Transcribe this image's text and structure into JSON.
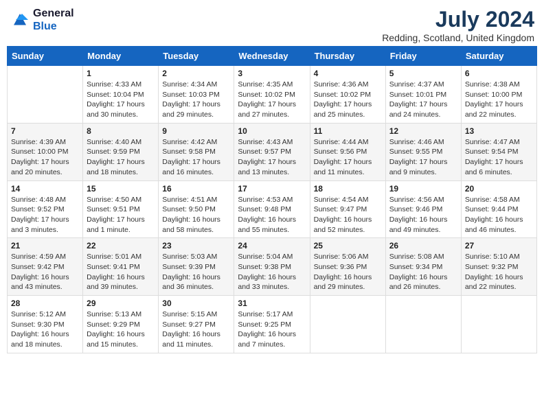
{
  "header": {
    "logo_general": "General",
    "logo_blue": "Blue",
    "month_title": "July 2024",
    "location": "Redding, Scotland, United Kingdom"
  },
  "weekdays": [
    "Sunday",
    "Monday",
    "Tuesday",
    "Wednesday",
    "Thursday",
    "Friday",
    "Saturday"
  ],
  "weeks": [
    [
      {
        "day": "",
        "sunrise": "",
        "sunset": "",
        "daylight": ""
      },
      {
        "day": "1",
        "sunrise": "Sunrise: 4:33 AM",
        "sunset": "Sunset: 10:04 PM",
        "daylight": "Daylight: 17 hours and 30 minutes."
      },
      {
        "day": "2",
        "sunrise": "Sunrise: 4:34 AM",
        "sunset": "Sunset: 10:03 PM",
        "daylight": "Daylight: 17 hours and 29 minutes."
      },
      {
        "day": "3",
        "sunrise": "Sunrise: 4:35 AM",
        "sunset": "Sunset: 10:02 PM",
        "daylight": "Daylight: 17 hours and 27 minutes."
      },
      {
        "day": "4",
        "sunrise": "Sunrise: 4:36 AM",
        "sunset": "Sunset: 10:02 PM",
        "daylight": "Daylight: 17 hours and 25 minutes."
      },
      {
        "day": "5",
        "sunrise": "Sunrise: 4:37 AM",
        "sunset": "Sunset: 10:01 PM",
        "daylight": "Daylight: 17 hours and 24 minutes."
      },
      {
        "day": "6",
        "sunrise": "Sunrise: 4:38 AM",
        "sunset": "Sunset: 10:00 PM",
        "daylight": "Daylight: 17 hours and 22 minutes."
      }
    ],
    [
      {
        "day": "7",
        "sunrise": "Sunrise: 4:39 AM",
        "sunset": "Sunset: 10:00 PM",
        "daylight": "Daylight: 17 hours and 20 minutes."
      },
      {
        "day": "8",
        "sunrise": "Sunrise: 4:40 AM",
        "sunset": "Sunset: 9:59 PM",
        "daylight": "Daylight: 17 hours and 18 minutes."
      },
      {
        "day": "9",
        "sunrise": "Sunrise: 4:42 AM",
        "sunset": "Sunset: 9:58 PM",
        "daylight": "Daylight: 17 hours and 16 minutes."
      },
      {
        "day": "10",
        "sunrise": "Sunrise: 4:43 AM",
        "sunset": "Sunset: 9:57 PM",
        "daylight": "Daylight: 17 hours and 13 minutes."
      },
      {
        "day": "11",
        "sunrise": "Sunrise: 4:44 AM",
        "sunset": "Sunset: 9:56 PM",
        "daylight": "Daylight: 17 hours and 11 minutes."
      },
      {
        "day": "12",
        "sunrise": "Sunrise: 4:46 AM",
        "sunset": "Sunset: 9:55 PM",
        "daylight": "Daylight: 17 hours and 9 minutes."
      },
      {
        "day": "13",
        "sunrise": "Sunrise: 4:47 AM",
        "sunset": "Sunset: 9:54 PM",
        "daylight": "Daylight: 17 hours and 6 minutes."
      }
    ],
    [
      {
        "day": "14",
        "sunrise": "Sunrise: 4:48 AM",
        "sunset": "Sunset: 9:52 PM",
        "daylight": "Daylight: 17 hours and 3 minutes."
      },
      {
        "day": "15",
        "sunrise": "Sunrise: 4:50 AM",
        "sunset": "Sunset: 9:51 PM",
        "daylight": "Daylight: 17 hours and 1 minute."
      },
      {
        "day": "16",
        "sunrise": "Sunrise: 4:51 AM",
        "sunset": "Sunset: 9:50 PM",
        "daylight": "Daylight: 16 hours and 58 minutes."
      },
      {
        "day": "17",
        "sunrise": "Sunrise: 4:53 AM",
        "sunset": "Sunset: 9:48 PM",
        "daylight": "Daylight: 16 hours and 55 minutes."
      },
      {
        "day": "18",
        "sunrise": "Sunrise: 4:54 AM",
        "sunset": "Sunset: 9:47 PM",
        "daylight": "Daylight: 16 hours and 52 minutes."
      },
      {
        "day": "19",
        "sunrise": "Sunrise: 4:56 AM",
        "sunset": "Sunset: 9:46 PM",
        "daylight": "Daylight: 16 hours and 49 minutes."
      },
      {
        "day": "20",
        "sunrise": "Sunrise: 4:58 AM",
        "sunset": "Sunset: 9:44 PM",
        "daylight": "Daylight: 16 hours and 46 minutes."
      }
    ],
    [
      {
        "day": "21",
        "sunrise": "Sunrise: 4:59 AM",
        "sunset": "Sunset: 9:42 PM",
        "daylight": "Daylight: 16 hours and 43 minutes."
      },
      {
        "day": "22",
        "sunrise": "Sunrise: 5:01 AM",
        "sunset": "Sunset: 9:41 PM",
        "daylight": "Daylight: 16 hours and 39 minutes."
      },
      {
        "day": "23",
        "sunrise": "Sunrise: 5:03 AM",
        "sunset": "Sunset: 9:39 PM",
        "daylight": "Daylight: 16 hours and 36 minutes."
      },
      {
        "day": "24",
        "sunrise": "Sunrise: 5:04 AM",
        "sunset": "Sunset: 9:38 PM",
        "daylight": "Daylight: 16 hours and 33 minutes."
      },
      {
        "day": "25",
        "sunrise": "Sunrise: 5:06 AM",
        "sunset": "Sunset: 9:36 PM",
        "daylight": "Daylight: 16 hours and 29 minutes."
      },
      {
        "day": "26",
        "sunrise": "Sunrise: 5:08 AM",
        "sunset": "Sunset: 9:34 PM",
        "daylight": "Daylight: 16 hours and 26 minutes."
      },
      {
        "day": "27",
        "sunrise": "Sunrise: 5:10 AM",
        "sunset": "Sunset: 9:32 PM",
        "daylight": "Daylight: 16 hours and 22 minutes."
      }
    ],
    [
      {
        "day": "28",
        "sunrise": "Sunrise: 5:12 AM",
        "sunset": "Sunset: 9:30 PM",
        "daylight": "Daylight: 16 hours and 18 minutes."
      },
      {
        "day": "29",
        "sunrise": "Sunrise: 5:13 AM",
        "sunset": "Sunset: 9:29 PM",
        "daylight": "Daylight: 16 hours and 15 minutes."
      },
      {
        "day": "30",
        "sunrise": "Sunrise: 5:15 AM",
        "sunset": "Sunset: 9:27 PM",
        "daylight": "Daylight: 16 hours and 11 minutes."
      },
      {
        "day": "31",
        "sunrise": "Sunrise: 5:17 AM",
        "sunset": "Sunset: 9:25 PM",
        "daylight": "Daylight: 16 hours and 7 minutes."
      },
      {
        "day": "",
        "sunrise": "",
        "sunset": "",
        "daylight": ""
      },
      {
        "day": "",
        "sunrise": "",
        "sunset": "",
        "daylight": ""
      },
      {
        "day": "",
        "sunrise": "",
        "sunset": "",
        "daylight": ""
      }
    ]
  ]
}
